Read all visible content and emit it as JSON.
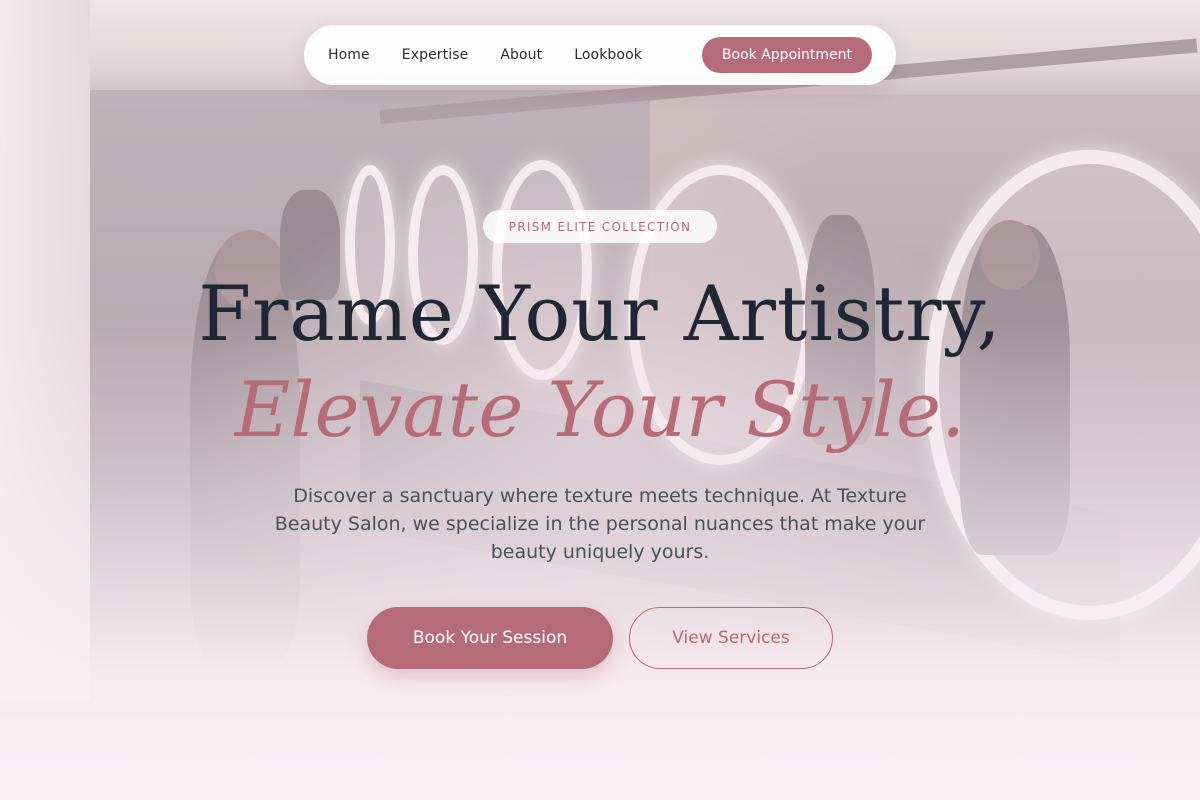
{
  "nav": {
    "items": [
      {
        "label": "Home"
      },
      {
        "label": "Expertise"
      },
      {
        "label": "About"
      },
      {
        "label": "Lookbook"
      }
    ],
    "cta_label": "Book Appointment"
  },
  "hero": {
    "badge": "PRISM ELITE COLLECTION",
    "headline_line1": "Frame Your Artistry,",
    "headline_line2": "Elevate Your Style.",
    "description": "Discover a sanctuary where texture meets technique. At Texture Beauty Salon, we specialize in the personal nuances that make your beauty uniquely yours.",
    "primary_button": "Book Your Session",
    "secondary_button": "View Services"
  },
  "colors": {
    "accent": "#b66c78",
    "heading": "#1f2735",
    "body_text": "#4c4f5a",
    "background": "#fcf0f5"
  },
  "background_image": "salon-interior-photo"
}
